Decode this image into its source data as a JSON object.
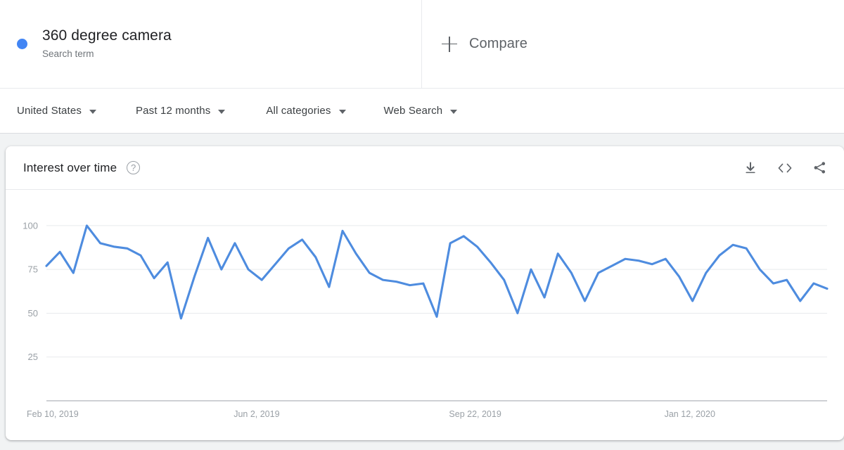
{
  "query": {
    "dot_color": "#4285f4",
    "term": "360 degree camera",
    "type_label": "Search term",
    "compare_label": "Compare",
    "plus_icon": "plus-icon"
  },
  "filters": [
    {
      "label": "United States",
      "icon": "chevron-down-icon"
    },
    {
      "label": "Past 12 months",
      "icon": "chevron-down-icon"
    },
    {
      "label": "All categories",
      "icon": "chevron-down-icon"
    },
    {
      "label": "Web Search",
      "icon": "chevron-down-icon"
    }
  ],
  "card": {
    "title": "Interest over time",
    "help_icon": "help-circle-icon",
    "help_glyph": "?",
    "actions": [
      {
        "name": "download-icon",
        "tooltip": "Download"
      },
      {
        "name": "embed-code-icon",
        "tooltip": "Embed"
      },
      {
        "name": "share-icon",
        "tooltip": "Share"
      }
    ]
  },
  "chart_data": {
    "type": "line",
    "title": "Interest over time",
    "xlabel": "",
    "ylabel": "",
    "ylim": [
      0,
      110
    ],
    "yticks": [
      25,
      50,
      75,
      100
    ],
    "grid": true,
    "legend": false,
    "line_color": "#4e8cdf",
    "xticks": [
      "Feb 10, 2019",
      "Jun 2, 2019",
      "Sep 22, 2019",
      "Jan 12, 2020"
    ],
    "xtick_indices": [
      0,
      16,
      32,
      48
    ],
    "series": [
      {
        "name": "360 degree camera",
        "values": [
          77,
          85,
          73,
          100,
          90,
          88,
          87,
          83,
          70,
          79,
          47,
          71,
          93,
          75,
          90,
          75,
          69,
          78,
          87,
          92,
          82,
          65,
          97,
          84,
          73,
          69,
          68,
          66,
          67,
          48,
          90,
          94,
          88,
          79,
          69,
          50,
          75,
          59,
          84,
          73,
          57,
          73,
          77,
          81,
          80,
          78,
          81,
          71,
          57,
          73,
          83,
          89,
          87,
          75,
          67,
          69,
          57,
          67,
          64
        ]
      }
    ]
  }
}
